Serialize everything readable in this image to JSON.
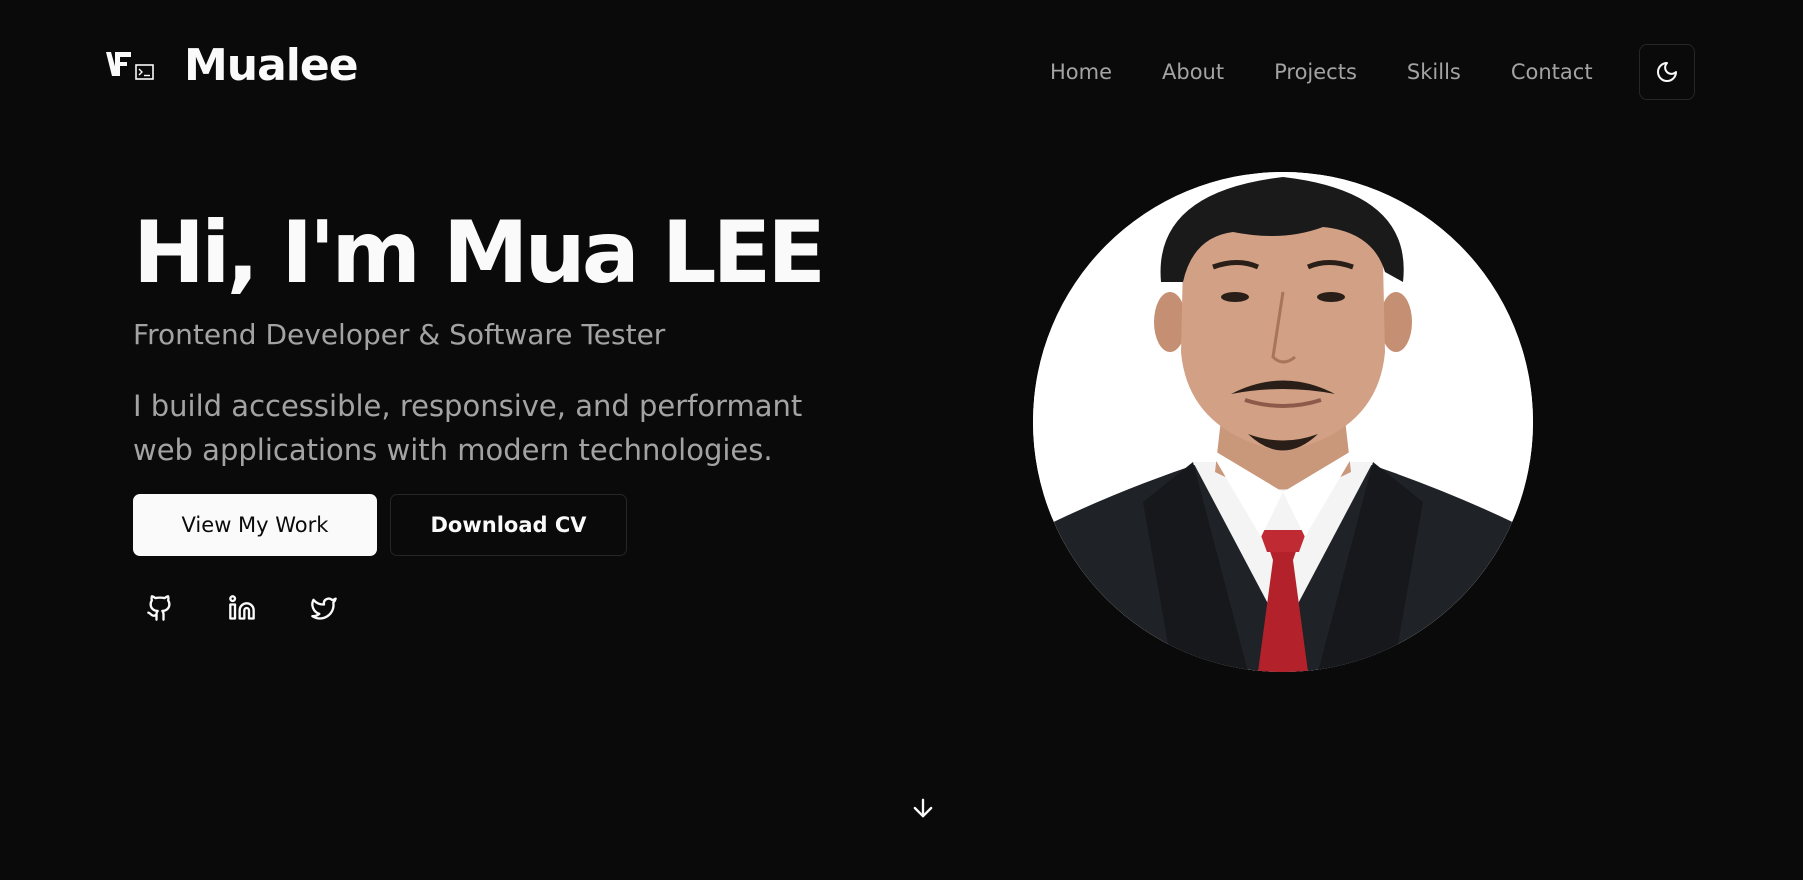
{
  "header": {
    "brand_name": "Mualee",
    "logo_icon": "vf-terminal-logo-icon",
    "nav": [
      {
        "label": "Home"
      },
      {
        "label": "About"
      },
      {
        "label": "Projects"
      },
      {
        "label": "Skills"
      },
      {
        "label": "Contact"
      }
    ],
    "theme_toggle_icon": "moon-icon"
  },
  "hero": {
    "title": "Hi, I'm Mua LEE",
    "subtitle": "Frontend Developer & Software Tester",
    "description": "I build accessible, responsive, and performant web applications with modern technologies.",
    "primary_button": "View My Work",
    "secondary_button": "Download CV",
    "socials": [
      {
        "icon": "github-icon"
      },
      {
        "icon": "linkedin-icon"
      },
      {
        "icon": "twitter-icon"
      }
    ],
    "profile_photo": "profile-photo"
  },
  "scroll_icon": "arrow-down-icon",
  "colors": {
    "background": "#0a0a0a",
    "foreground": "#fafafa",
    "muted": "#a3a3a3",
    "border": "#262626"
  }
}
